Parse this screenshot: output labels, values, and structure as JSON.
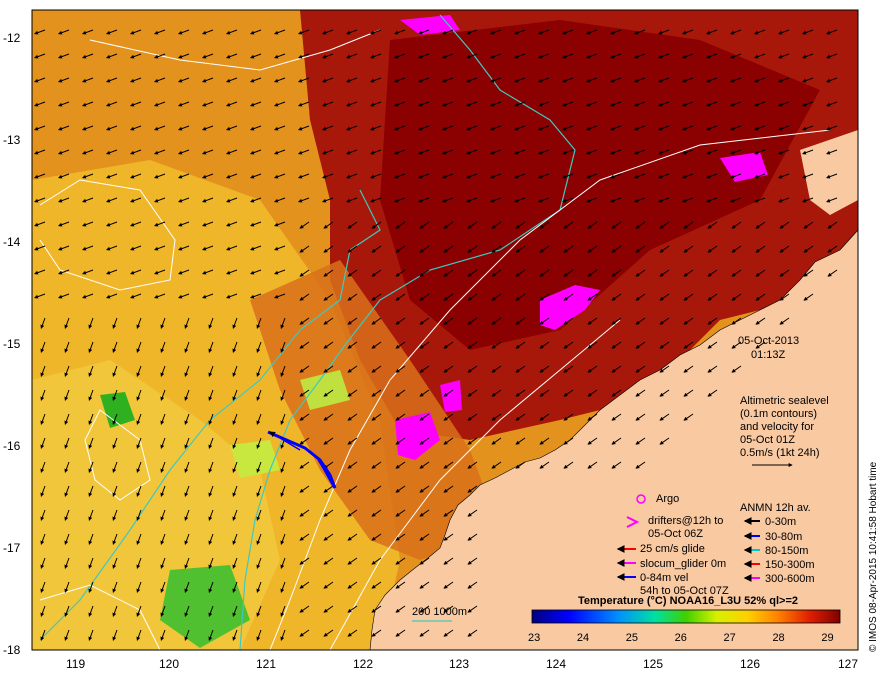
{
  "map": {
    "y_axis_labels": [
      "-12",
      "-13",
      "-14",
      "-15",
      "-16",
      "-17",
      "-18"
    ],
    "x_axis_labels": [
      "119",
      "120",
      "121",
      "122",
      "123",
      "124",
      "125",
      "126",
      "127"
    ],
    "lat_range": [
      -18,
      -11.7
    ],
    "lon_range": [
      118.6,
      127
    ]
  },
  "datetime": {
    "date": "05-Oct-2013",
    "time": "01:13Z"
  },
  "altimetry": {
    "lines": [
      "Altimetric sealevel",
      "(0.1m contours)",
      "and velocity for",
      "05-Oct 01Z",
      "0.5m/s (1kt 24h)"
    ]
  },
  "legend": {
    "argo": "Argo",
    "drifters": [
      "drifters@12h to",
      "05-Oct 06Z"
    ],
    "glide": "25 cm/s glide",
    "glider": "slocum_glider 0m",
    "vel": [
      "0-84m vel",
      "54h to 05-Oct 07Z"
    ],
    "anmn_title": "ANMN 12h av.",
    "anmn": [
      "0-30m",
      "30-80m",
      "80-150m",
      "150-300m",
      "300-600m"
    ]
  },
  "isobath_label": "200  1000m",
  "colorbar": {
    "title": "Temperature (°C) NOAA16_L3U 52% ql>=2",
    "ticks": [
      "23",
      "24",
      "25",
      "26",
      "27",
      "28",
      "29"
    ],
    "range": [
      23,
      29.3
    ]
  },
  "credit": "© IMOS 08-Apr-2015 10:41:58 Hobart time",
  "colors": {
    "land": "#f9c9a2",
    "warm": "#8b0000",
    "mid": "#d86a10",
    "cool": "#f0c020",
    "green": "#2fb020",
    "magenta": "#ff00ff",
    "isobath": "#40c8c0"
  }
}
